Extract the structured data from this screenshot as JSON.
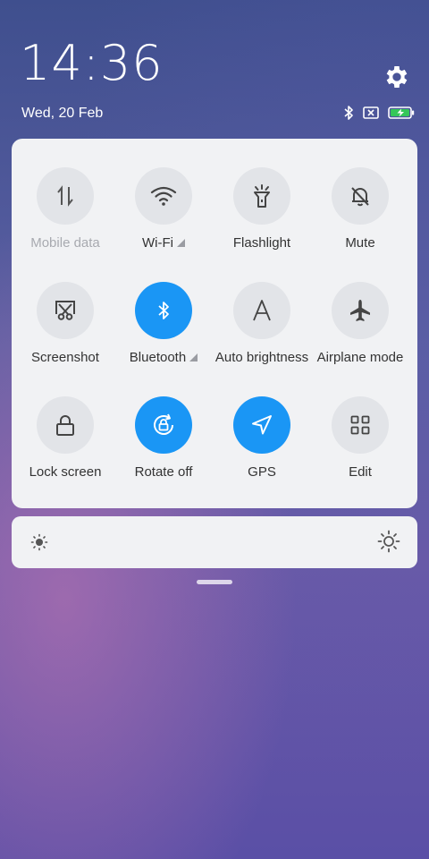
{
  "status": {
    "time": "14:36",
    "date": "Wed, 20 Feb",
    "icons": [
      "bluetooth-icon",
      "no-sim-icon",
      "battery-charging-icon"
    ]
  },
  "settings_icon": "gear-icon",
  "tiles": [
    {
      "label": "Mobile data",
      "icon": "mobile-data-icon",
      "active": false,
      "disabled": true
    },
    {
      "label": "Wi-Fi",
      "icon": "wifi-icon",
      "active": false,
      "has_menu": true
    },
    {
      "label": "Flashlight",
      "icon": "flashlight-icon",
      "active": false
    },
    {
      "label": "Mute",
      "icon": "mute-bell-icon",
      "active": false
    },
    {
      "label": "Screenshot",
      "icon": "screenshot-icon",
      "active": false
    },
    {
      "label": "Bluetooth",
      "icon": "bluetooth-icon",
      "active": true,
      "has_menu": true
    },
    {
      "label": "Auto brightness",
      "icon": "auto-brightness-icon",
      "active": false
    },
    {
      "label": "Airplane mode",
      "icon": "airplane-icon",
      "active": false
    },
    {
      "label": "Lock screen",
      "icon": "lock-icon",
      "active": false
    },
    {
      "label": "Rotate off",
      "icon": "rotate-lock-icon",
      "active": true
    },
    {
      "label": "GPS",
      "icon": "gps-icon",
      "active": true
    },
    {
      "label": "Edit",
      "icon": "grid-edit-icon",
      "active": false
    }
  ],
  "brightness": {
    "low_icon": "sun-small-icon",
    "high_icon": "sun-large-icon"
  },
  "colors": {
    "accent": "#1a96f5",
    "panel": "#f1f2f4",
    "inactive_circle": "#e2e4e8"
  }
}
